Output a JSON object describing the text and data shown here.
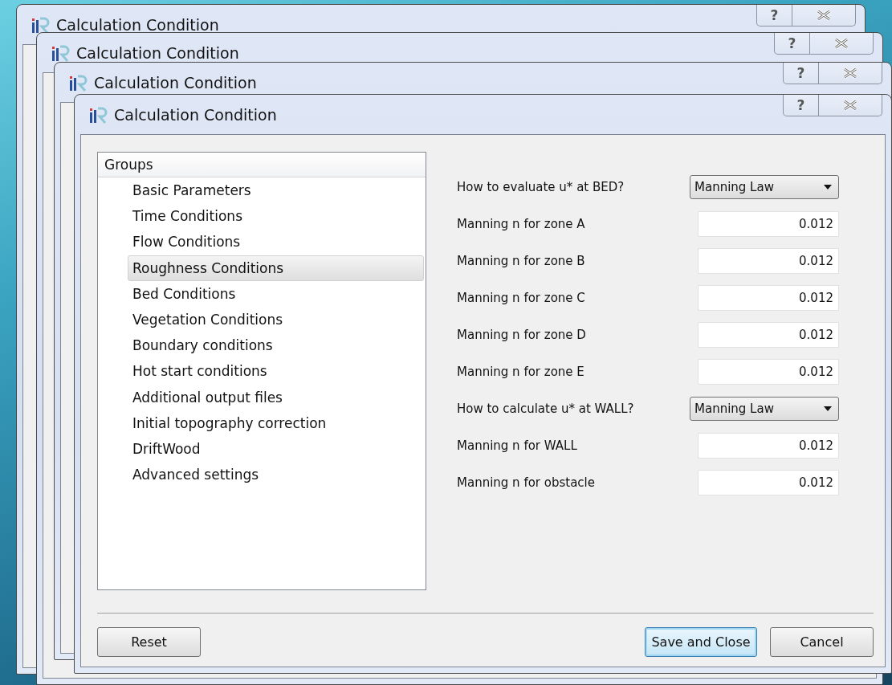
{
  "background_windows": [
    {
      "title": "Calculation Condition",
      "help_button": "?"
    },
    {
      "title": "Calculation Condition",
      "help_button": "?"
    },
    {
      "title": "Calculation Condition",
      "help_button": "?"
    }
  ],
  "dialog": {
    "title": "Calculation Condition",
    "help_button": "?",
    "groups": {
      "header": "Groups",
      "items": [
        {
          "label": "Basic Parameters",
          "selected": false
        },
        {
          "label": "Time Conditions",
          "selected": false
        },
        {
          "label": "Flow Conditions",
          "selected": false
        },
        {
          "label": "Roughness Conditions",
          "selected": true
        },
        {
          "label": "Bed Conditions",
          "selected": false
        },
        {
          "label": "Vegetation Conditions",
          "selected": false
        },
        {
          "label": "Boundary conditions",
          "selected": false
        },
        {
          "label": "Hot start conditions",
          "selected": false
        },
        {
          "label": "Additional output files",
          "selected": false
        },
        {
          "label": "Initial topography correction",
          "selected": false
        },
        {
          "label": "DriftWood",
          "selected": false
        },
        {
          "label": "Advanced settings",
          "selected": false
        }
      ]
    },
    "fields": [
      {
        "kind": "dropdown",
        "label": "How to evaluate u* at BED?",
        "value": "Manning Law"
      },
      {
        "kind": "number",
        "label": "Manning n for zone A",
        "value": "0.012"
      },
      {
        "kind": "number",
        "label": "Manning n for zone B",
        "value": "0.012"
      },
      {
        "kind": "number",
        "label": "Manning n for zone C",
        "value": "0.012"
      },
      {
        "kind": "number",
        "label": "Manning n for zone D",
        "value": "0.012"
      },
      {
        "kind": "number",
        "label": "Manning n for zone E",
        "value": "0.012"
      },
      {
        "kind": "dropdown",
        "label": "How to calculate u* at WALL?",
        "value": "Manning Law"
      },
      {
        "kind": "number",
        "label": "Manning n for WALL",
        "value": "0.012"
      },
      {
        "kind": "number",
        "label": "Manning n for obstacle",
        "value": "0.012"
      }
    ],
    "buttons": [
      {
        "label": "Reset",
        "focused": false
      },
      {
        "label": "Save and Close",
        "focused": true
      },
      {
        "label": "Cancel",
        "focused": false
      }
    ]
  }
}
